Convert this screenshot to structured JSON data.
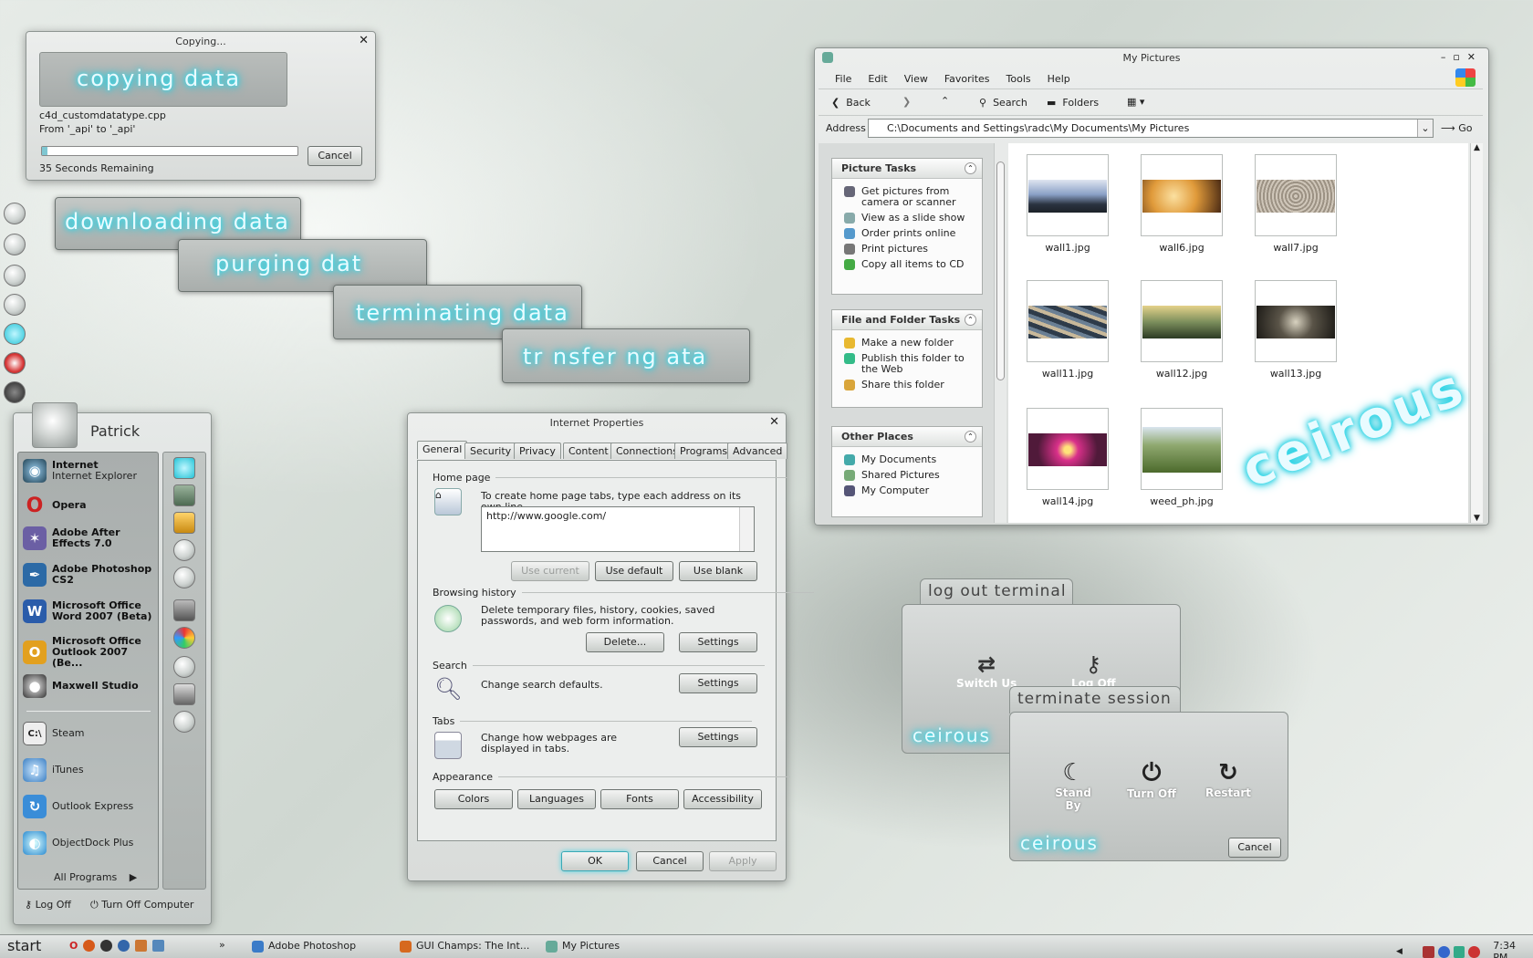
{
  "copying": {
    "title": "Copying...",
    "banner": "copying data",
    "file": "c4d_customdatatype.cpp",
    "from": "From '_api' to '_api'",
    "remaining": "35 Seconds Remaining",
    "cancel": "Cancel",
    "progress": 0.02
  },
  "banners": [
    "downloading data",
    "purging dat",
    "terminating data",
    "tr  nsfer ng  ata"
  ],
  "startmenu": {
    "user": "Patrick",
    "pinned": [
      {
        "title": "Internet",
        "sub": "Internet Explorer"
      },
      {
        "title": "Opera",
        "sub": ""
      },
      {
        "title": "Adobe After Effects 7.0",
        "sub": ""
      },
      {
        "title": "Adobe Photoshop CS2",
        "sub": ""
      },
      {
        "title": "Microsoft Office Word 2007 (Beta)",
        "sub": ""
      },
      {
        "title": "Microsoft Office Outlook 2007 (Be...",
        "sub": ""
      },
      {
        "title": "Maxwell Studio",
        "sub": ""
      }
    ],
    "recent": [
      "Steam",
      "iTunes",
      "Outlook Express",
      "ObjectDock Plus"
    ],
    "all_programs": "All Programs",
    "logoff": "Log Off",
    "turnoff": "Turn Off Computer"
  },
  "explorer": {
    "title": "My Pictures",
    "menu": [
      "File",
      "Edit",
      "View",
      "Favorites",
      "Tools",
      "Help"
    ],
    "toolbar": {
      "back": "Back",
      "search": "Search",
      "folders": "Folders"
    },
    "address_label": "Address",
    "address": "C:\\Documents and Settings\\radc\\My Documents\\My Pictures",
    "go": "Go",
    "picture_tasks": {
      "title": "Picture Tasks",
      "items": [
        "Get pictures from camera or scanner",
        "View as a slide show",
        "Order prints online",
        "Print pictures",
        "Copy all items to CD"
      ]
    },
    "file_tasks": {
      "title": "File and Folder Tasks",
      "items": [
        "Make a new folder",
        "Publish this folder to the Web",
        "Share this folder"
      ]
    },
    "other_places": {
      "title": "Other Places",
      "items": [
        "My Documents",
        "Shared Pictures",
        "My Computer"
      ]
    },
    "files": [
      "wall1.jpg",
      "wall6.jpg",
      "wall7.jpg",
      "wall11.jpg",
      "wall12.jpg",
      "wall13.jpg",
      "wall14.jpg",
      "weed_ph.jpg"
    ],
    "watermark": "ceirous"
  },
  "iprops": {
    "title": "Internet Properties",
    "tabs": [
      "General",
      "Security",
      "Privacy",
      "Content",
      "Connections",
      "Programs",
      "Advanced"
    ],
    "home_label": "Home page",
    "home_text": "To create home page tabs, type each address on its own line.",
    "home_url": "http://www.google.com/",
    "use_current": "Use current",
    "use_default": "Use default",
    "use_blank": "Use blank",
    "history_label": "Browsing history",
    "history_text": "Delete temporary files, history, cookies, saved passwords, and web form information.",
    "delete": "Delete...",
    "settings": "Settings",
    "search_label": "Search",
    "search_text": "Change search defaults.",
    "tabs_label": "Tabs",
    "tabs_text": "Change how webpages are displayed in tabs.",
    "appearance_label": "Appearance",
    "colors": "Colors",
    "languages": "Languages",
    "fonts": "Fonts",
    "accessibility": "Accessibility",
    "ok": "OK",
    "cancel": "Cancel",
    "apply": "Apply"
  },
  "logout": {
    "title": "log out terminal",
    "switch": "Switch Us",
    "logoff": "Log Off",
    "brand": "ceirous"
  },
  "terminate": {
    "title": "terminate session",
    "standby": "Stand By",
    "turnoff": "Turn Off",
    "restart": "Restart",
    "cancel": "Cancel",
    "brand": "ceirous"
  },
  "taskbar": {
    "start": "start",
    "items": [
      "Adobe Photoshop",
      "GUI Champs: The Int...",
      "My Pictures"
    ],
    "clock": "7:34 PM"
  }
}
